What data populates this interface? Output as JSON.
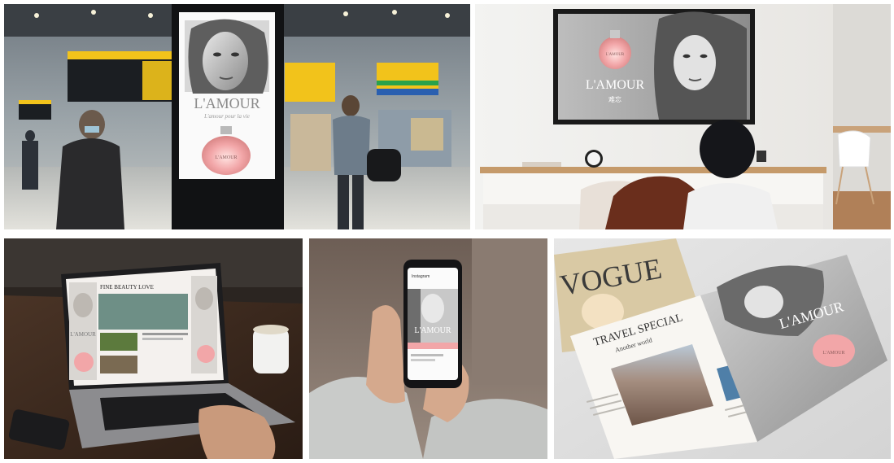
{
  "brand": {
    "name": "L'AMOUR",
    "tagline_fr": "L'amour pour la vie",
    "subtitle_cn": "难忘",
    "bottle_label": "L'AMOUR"
  },
  "laptop": {
    "site_title": "FINE BEAUTY LOVE"
  },
  "phone": {
    "app_name": "Instagram"
  },
  "magazine": {
    "cover_title": "VOGUE",
    "headline": "TRAVEL SPECIAL",
    "subhead": "Another world"
  },
  "colors": {
    "signage_yellow": "#f2c31b",
    "bottle_pink": "#f2a6a8",
    "wood": "#c59a6a"
  }
}
